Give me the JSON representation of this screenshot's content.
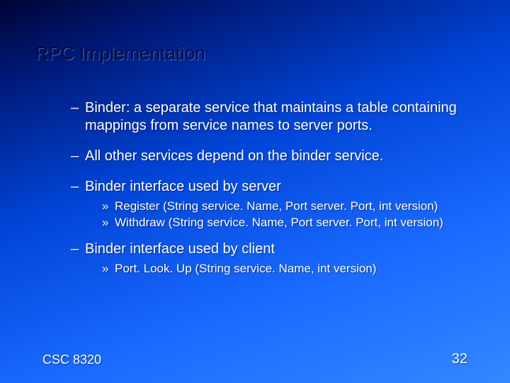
{
  "title": "RPC Implementation",
  "bullets": [
    {
      "text": "Binder: a separate service that maintains a table containing mappings from service names to server ports.",
      "sub": []
    },
    {
      "text": "All other services depend on the binder service.",
      "sub": []
    },
    {
      "text": "Binder interface used by server",
      "sub": [
        "Register (String service. Name, Port server. Port, int version)",
        "Withdraw (String service. Name, Port server. Port, int version)"
      ]
    },
    {
      "text": "Binder interface used by client",
      "sub": [
        "Port. Look. Up (String service. Name, int version)"
      ]
    }
  ],
  "footer": {
    "course": "CSC 8320",
    "page": "32"
  }
}
